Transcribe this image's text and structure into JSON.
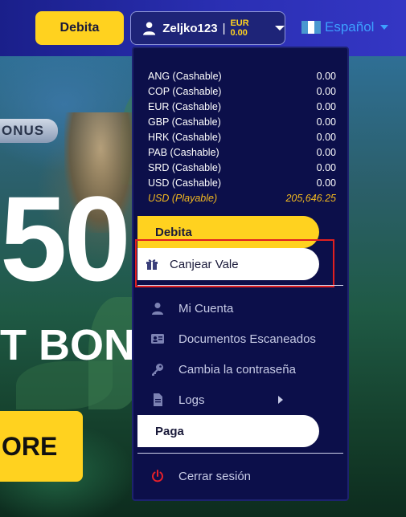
{
  "header": {
    "deposit_label": "Debita",
    "username": "Zeljko123",
    "separator": "|",
    "balance": "EUR 0.00",
    "language": "Español"
  },
  "hero": {
    "badge": "ONUS",
    "big_number": "50",
    "bonus_text": "T BON",
    "more_button": "ORE"
  },
  "dropdown": {
    "balances": [
      {
        "label": "ANG (Cashable)",
        "value": "0.00"
      },
      {
        "label": "COP (Cashable)",
        "value": "0.00"
      },
      {
        "label": "EUR (Cashable)",
        "value": "0.00"
      },
      {
        "label": "GBP (Cashable)",
        "value": "0.00"
      },
      {
        "label": "HRK (Cashable)",
        "value": "0.00"
      },
      {
        "label": "PAB (Cashable)",
        "value": "0.00"
      },
      {
        "label": "SRD (Cashable)",
        "value": "0.00"
      },
      {
        "label": "USD (Cashable)",
        "value": "0.00"
      },
      {
        "label": "USD (Playable)",
        "value": "205,646.25"
      }
    ],
    "deposit_label": "Debita",
    "voucher_label": "Canjear Vale",
    "account_label": "Mi Cuenta",
    "documents_label": "Documentos Escaneados",
    "password_label": "Cambia la contraseña",
    "logs_label": "Logs",
    "withdraw_label": "Paga",
    "logout_label": "Cerrar sesión"
  },
  "colors": {
    "accent_yellow": "#ffd21f",
    "header_blue": "#2a2fb3",
    "dropdown_bg": "#0c0f4a",
    "highlight_red": "#e02020",
    "playable_gold": "#f2b81f",
    "logout_red": "#e8202a"
  },
  "icons": {
    "user": "user-icon",
    "gift": "gift-icon",
    "account": "user-icon",
    "documents": "id-card-icon",
    "password": "key-icon",
    "logs": "file-icon",
    "logout": "power-icon"
  }
}
